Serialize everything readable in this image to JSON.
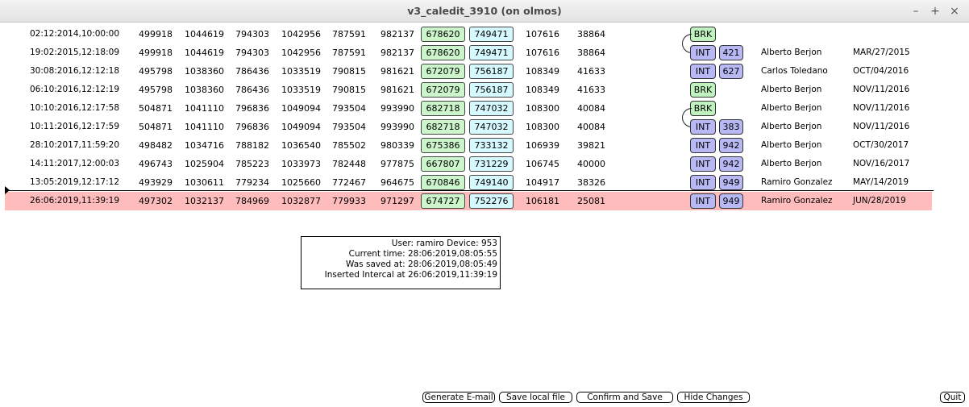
{
  "window": {
    "title": "v3_caledit_3910 (on olmos)",
    "min_label": "–",
    "max_label": "+",
    "close_label": "×"
  },
  "rows": [
    {
      "date": "02:12:2014,10:00:00",
      "c1": "499918",
      "c2": "1044619",
      "c3": "794303",
      "c4": "1042956",
      "c5": "787591",
      "c6": "982137",
      "g": "678620",
      "b": "749471",
      "c7": "107616",
      "c8": "38864",
      "type": "BRK",
      "num": "",
      "user": "",
      "saved": ""
    },
    {
      "date": "19:02:2015,12:18:09",
      "c1": "499918",
      "c2": "1044619",
      "c3": "794303",
      "c4": "1042956",
      "c5": "787591",
      "c6": "982137",
      "g": "678620",
      "b": "749471",
      "c7": "107616",
      "c8": "38864",
      "type": "INT",
      "num": "421",
      "user": "Alberto Berjon",
      "saved": "MAR/27/2015"
    },
    {
      "date": "30:08:2016,12:12:18",
      "c1": "495798",
      "c2": "1038360",
      "c3": "786436",
      "c4": "1033519",
      "c5": "790815",
      "c6": "981621",
      "g": "672079",
      "b": "756187",
      "c7": "108349",
      "c8": "41633",
      "type": "INT",
      "num": "627",
      "user": "Carlos Toledano",
      "saved": "OCT/04/2016"
    },
    {
      "date": "06:10:2016,12:12:19",
      "c1": "495798",
      "c2": "1038360",
      "c3": "786436",
      "c4": "1033519",
      "c5": "790815",
      "c6": "981621",
      "g": "672079",
      "b": "756187",
      "c7": "108349",
      "c8": "41633",
      "type": "BRK",
      "num": "",
      "user": "Alberto Berjon",
      "saved": "NOV/11/2016"
    },
    {
      "date": "10:10:2016,12:17:58",
      "c1": "504871",
      "c2": "1041110",
      "c3": "796836",
      "c4": "1049094",
      "c5": "793504",
      "c6": "993990",
      "g": "682718",
      "b": "747032",
      "c7": "108300",
      "c8": "40084",
      "type": "BRK",
      "num": "",
      "user": "Alberto Berjon",
      "saved": "NOV/11/2016"
    },
    {
      "date": "10:11:2016,12:17:59",
      "c1": "504871",
      "c2": "1041110",
      "c3": "796836",
      "c4": "1049094",
      "c5": "793504",
      "c6": "993990",
      "g": "682718",
      "b": "747032",
      "c7": "108300",
      "c8": "40084",
      "type": "INT",
      "num": "383",
      "user": "Alberto Berjon",
      "saved": "NOV/11/2016"
    },
    {
      "date": "28:10:2017,11:59:20",
      "c1": "498482",
      "c2": "1034716",
      "c3": "788182",
      "c4": "1036540",
      "c5": "785502",
      "c6": "980339",
      "g": "675386",
      "b": "733132",
      "c7": "106939",
      "c8": "39821",
      "type": "INT",
      "num": "942",
      "user": "Alberto Berjon",
      "saved": "OCT/30/2017"
    },
    {
      "date": "14:11:2017,12:00:03",
      "c1": "496743",
      "c2": "1025904",
      "c3": "785223",
      "c4": "1033973",
      "c5": "782448",
      "c6": "977875",
      "g": "667807",
      "b": "731229",
      "c7": "106745",
      "c8": "40000",
      "type": "INT",
      "num": "942",
      "user": "Alberto Berjon",
      "saved": "NOV/16/2017"
    },
    {
      "date": "13:05:2019,12:17:12",
      "c1": "493929",
      "c2": "1030611",
      "c3": "779234",
      "c4": "1025660",
      "c5": "772467",
      "c6": "964675",
      "g": "670846",
      "b": "749140",
      "c7": "104917",
      "c8": "38326",
      "type": "INT",
      "num": "949",
      "user": "Ramiro Gonzalez",
      "saved": "MAY/14/2019"
    },
    {
      "date": "26:06:2019,11:39:19",
      "c1": "497302",
      "c2": "1032137",
      "c3": "784969",
      "c4": "1032877",
      "c5": "779933",
      "c6": "971297",
      "g": "674727",
      "b": "752276",
      "c7": "106181",
      "c8": "25081",
      "type": "INT",
      "num": "949",
      "user": "Ramiro Gonzalez",
      "saved": "JUN/28/2019"
    }
  ],
  "info": {
    "line1": "User: ramiro Device: 953",
    "line2": "Current time: 28:06:2019,08:05:55",
    "line3": "Was saved at: 28:06:2019,08:05:49",
    "line4": "Inserted Intercal at 26:06:2019,11:39:19"
  },
  "buttons": {
    "generate_email": "Generate E-mail",
    "save_local": "Save local file",
    "confirm_save": "Confirm and Save",
    "hide_changes": "Hide Changes",
    "quit": "Quit"
  },
  "selected_row_index": 9,
  "colors": {
    "selected_row": "#ffbcbc",
    "green_box": "#ccf5cc",
    "cyan_box": "#d6f8ff",
    "int_badge": "#b8b8f4",
    "brk_badge": "#bff2bf"
  }
}
